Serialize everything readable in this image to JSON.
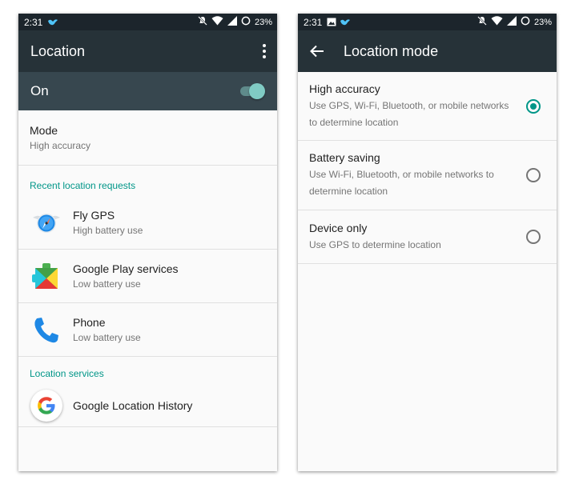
{
  "left_screen": {
    "status": {
      "time": "2:31",
      "battery": "23%"
    },
    "app_bar": {
      "title": "Location"
    },
    "master_toggle": {
      "label": "On",
      "state": "on"
    },
    "mode": {
      "title": "Mode",
      "value": "High accuracy"
    },
    "recent_header": "Recent location requests",
    "recent_requests": [
      {
        "name": "Fly GPS",
        "usage": "High battery use",
        "icon": "fly-gps-icon"
      },
      {
        "name": "Google Play services",
        "usage": "Low battery use",
        "icon": "google-play-services-icon"
      },
      {
        "name": "Phone",
        "usage": "Low battery use",
        "icon": "phone-icon"
      }
    ],
    "services_header": "Location services",
    "services": [
      {
        "name": "Google Location History",
        "icon": "google-g-icon"
      }
    ]
  },
  "right_screen": {
    "status": {
      "time": "2:31",
      "battery": "23%"
    },
    "app_bar": {
      "title": "Location mode"
    },
    "options": [
      {
        "title": "High accuracy",
        "desc_line1": "Use GPS, Wi-Fi, Bluetooth, or mobile networks",
        "desc_line2": "to determine location",
        "selected": true
      },
      {
        "title": "Battery saving",
        "desc_line1": "Use Wi-Fi, Bluetooth, or mobile networks to",
        "desc_line2": "determine location",
        "selected": false
      },
      {
        "title": "Device only",
        "desc_line1": "Use GPS to determine location",
        "desc_line2": "",
        "selected": false
      }
    ]
  },
  "colors": {
    "status_bar": "#1c252c",
    "app_bar": "#263238",
    "toggle_bar": "#37474f",
    "accent": "#009688",
    "background": "#fafafa"
  }
}
